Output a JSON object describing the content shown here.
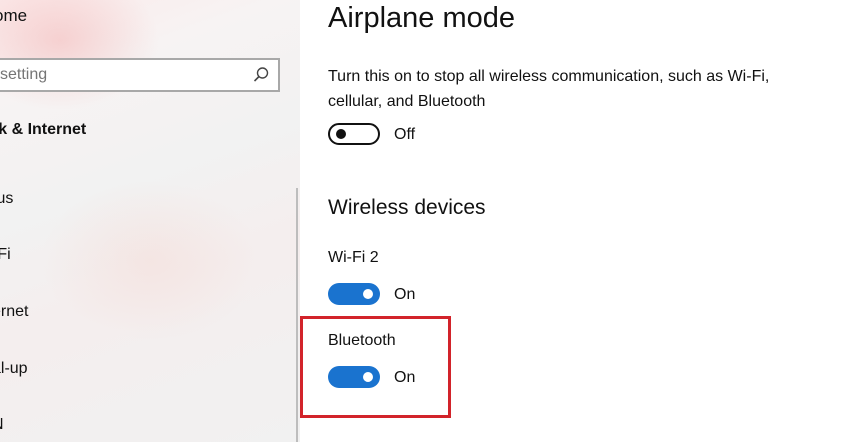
{
  "sidebar": {
    "home_label": "ome",
    "search": {
      "value": "",
      "placeholder": "setting"
    },
    "section_title": "rk & Internet",
    "items": [
      {
        "label": "tus"
      },
      {
        "label": "-Fi"
      },
      {
        "label": "ernet"
      },
      {
        "label": "al-up"
      },
      {
        "label": "N"
      }
    ]
  },
  "main": {
    "title": "Airplane mode",
    "airplane_description": "Turn this on to stop all wireless communication, such as Wi-Fi, cellular, and Bluetooth",
    "airplane_toggle": {
      "state_label": "Off",
      "on": false
    },
    "wireless_heading": "Wireless devices",
    "devices": [
      {
        "name": "Wi-Fi 2",
        "state_label": "On",
        "on": true
      },
      {
        "name": "Bluetooth",
        "state_label": "On",
        "on": true
      }
    ]
  },
  "colors": {
    "toggle_on": "#1a73cf",
    "highlight": "#d2232a"
  },
  "icons": {
    "search": "search-icon"
  }
}
